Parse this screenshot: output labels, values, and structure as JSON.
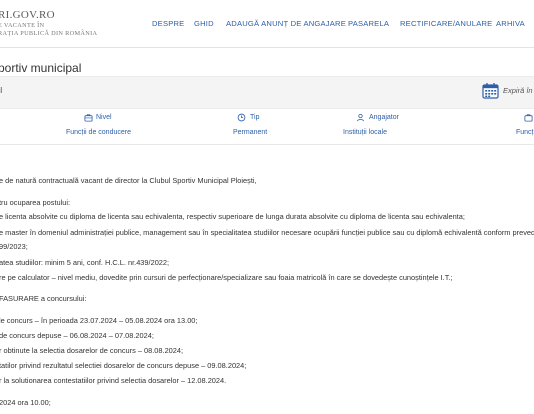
{
  "header": {
    "logo_title": "RI.GOV.RO",
    "logo_line1": "E VACANTE ÎN",
    "logo_line2": "RAȚIA PUBLICĂ DIN ROMÂNIA",
    "nav": [
      "DESPRE",
      "GHID",
      "ADAUGĂ ANUNȚ DE ANGAJARE",
      "PASARELA",
      "RECTIFICARE/ANULARE",
      "ARHIVA"
    ]
  },
  "page": {
    "title": "portiv municipal",
    "band_left": "il",
    "expira": "Expiră în"
  },
  "meta": {
    "nivel_label": "Nivel",
    "nivel_value": "Funcții de conducere",
    "tip_label": "Tip",
    "tip_value": "Permanent",
    "angajator_label": "Angajator",
    "angajator_value": "Instituții locale",
    "extra_value": "Funcț"
  },
  "content": {
    "lines": [
      "e de natură contractuală vacant de director la Clubul Sportiv Municipal Ploiești,",
      "tru ocuparea postului:",
      "e licenta absolvite cu diploma de licenta sau echivalenta, respectiv superioare de lunga durata absolvite cu diploma de licenta sau echivalenta;",
      "e master în domeniul administrației publice, management sau în specialitatea studiilor necesare ocupării funcției publice sau cu diplomă echivalentă conform preved",
      "99/2023;",
      "atea studiilor: minim 5 ani, conf. H.C.L. nr.439/2022;",
      "re pe calculator – nivel mediu, dovedite prin cursuri de perfecționare/specializare sau foaia matricolă în care se dovedește cunoștințele I.T.;",
      "FASURARE a concursului:",
      "le concurs – în perioada 23.07.2024 – 05.08.2024 ora 13.00;",
      "de concurs depuse – 06.08.2024 – 07.08.2024;",
      "r obtinute la selectia dosarelor de concurs – 08.08.2024;",
      "tatilor privind rezultatul selectiei dosarelor de concurs depuse – 09.08.2024;",
      "r la solutionarea contestatiilor privind selectia dosarelor – 12.08.2024.",
      "2024 ora 10.00;"
    ]
  }
}
